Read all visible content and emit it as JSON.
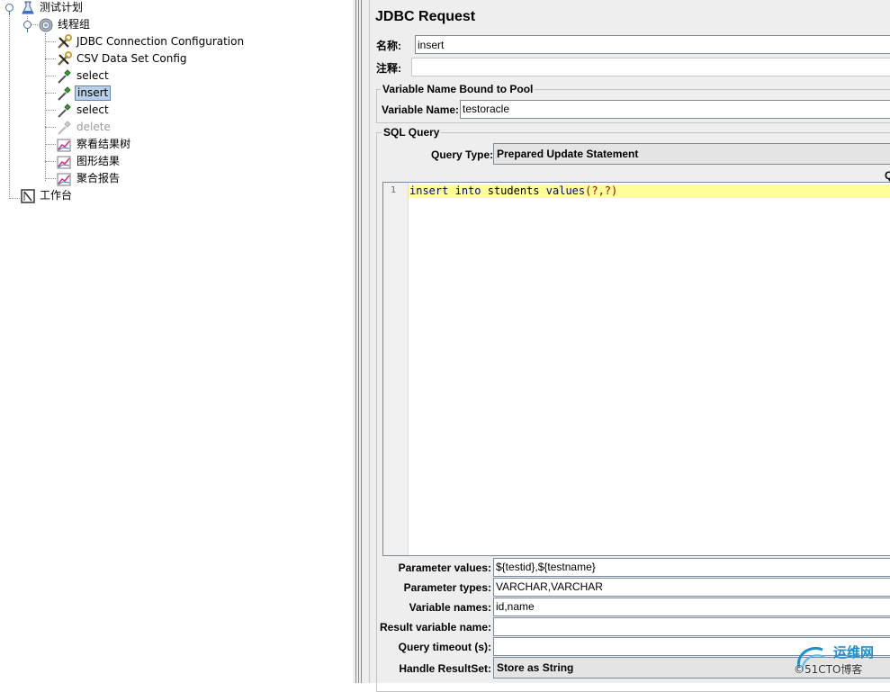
{
  "tree": {
    "plan": "测试计划",
    "thread_group": "线程组",
    "items": [
      {
        "label": "JDBC Connection Configuration",
        "icon": "wrench-icon",
        "disabled": false,
        "selected": false
      },
      {
        "label": "CSV Data Set Config",
        "icon": "wrench-icon",
        "disabled": false,
        "selected": false
      },
      {
        "label": "select",
        "icon": "pipette-icon",
        "disabled": false,
        "selected": false
      },
      {
        "label": "insert",
        "icon": "pipette-icon",
        "disabled": false,
        "selected": true
      },
      {
        "label": "select",
        "icon": "pipette-icon",
        "disabled": false,
        "selected": false
      },
      {
        "label": "delete",
        "icon": "pipette-icon",
        "disabled": true,
        "selected": false
      },
      {
        "label": "察看结果树",
        "icon": "graph-icon",
        "disabled": false,
        "selected": false
      },
      {
        "label": "图形结果",
        "icon": "graph-icon",
        "disabled": false,
        "selected": false
      },
      {
        "label": "聚合报告",
        "icon": "graph-icon",
        "disabled": false,
        "selected": false
      }
    ],
    "workbench": "工作台"
  },
  "panel": {
    "title": "JDBC Request",
    "name_label": "名称:",
    "name_value": "insert",
    "comment_label": "注释:",
    "comment_value": "",
    "pool_group_title": "Variable Name Bound to Pool",
    "varname_label": "Variable Name:",
    "varname_value": "testoracle",
    "sql_group_title": "SQL Query",
    "query_type_label": "Query Type:",
    "query_type_value": "Prepared Update Statement",
    "right_edge_text": "Q",
    "code_line_number": "1",
    "code": {
      "kw1": "insert",
      "kw2": "into",
      "table": "students",
      "kw3": "values",
      "args": "(?,?)"
    },
    "fields": [
      {
        "label": "Parameter values:",
        "value": "${testid},${testname}",
        "kind": "text"
      },
      {
        "label": "Parameter types:",
        "value": "VARCHAR,VARCHAR",
        "kind": "text"
      },
      {
        "label": "Variable names:",
        "value": "id,name",
        "kind": "text"
      },
      {
        "label": "Result variable name:",
        "value": "",
        "kind": "text"
      },
      {
        "label": "Query timeout (s):",
        "value": "",
        "kind": "text"
      },
      {
        "label": "Handle ResultSet:",
        "value": "Store as String",
        "kind": "combo"
      }
    ]
  },
  "watermark": {
    "brand": "运维网",
    "sub": "©51CTO博客",
    "color": "#1a8fd0"
  }
}
